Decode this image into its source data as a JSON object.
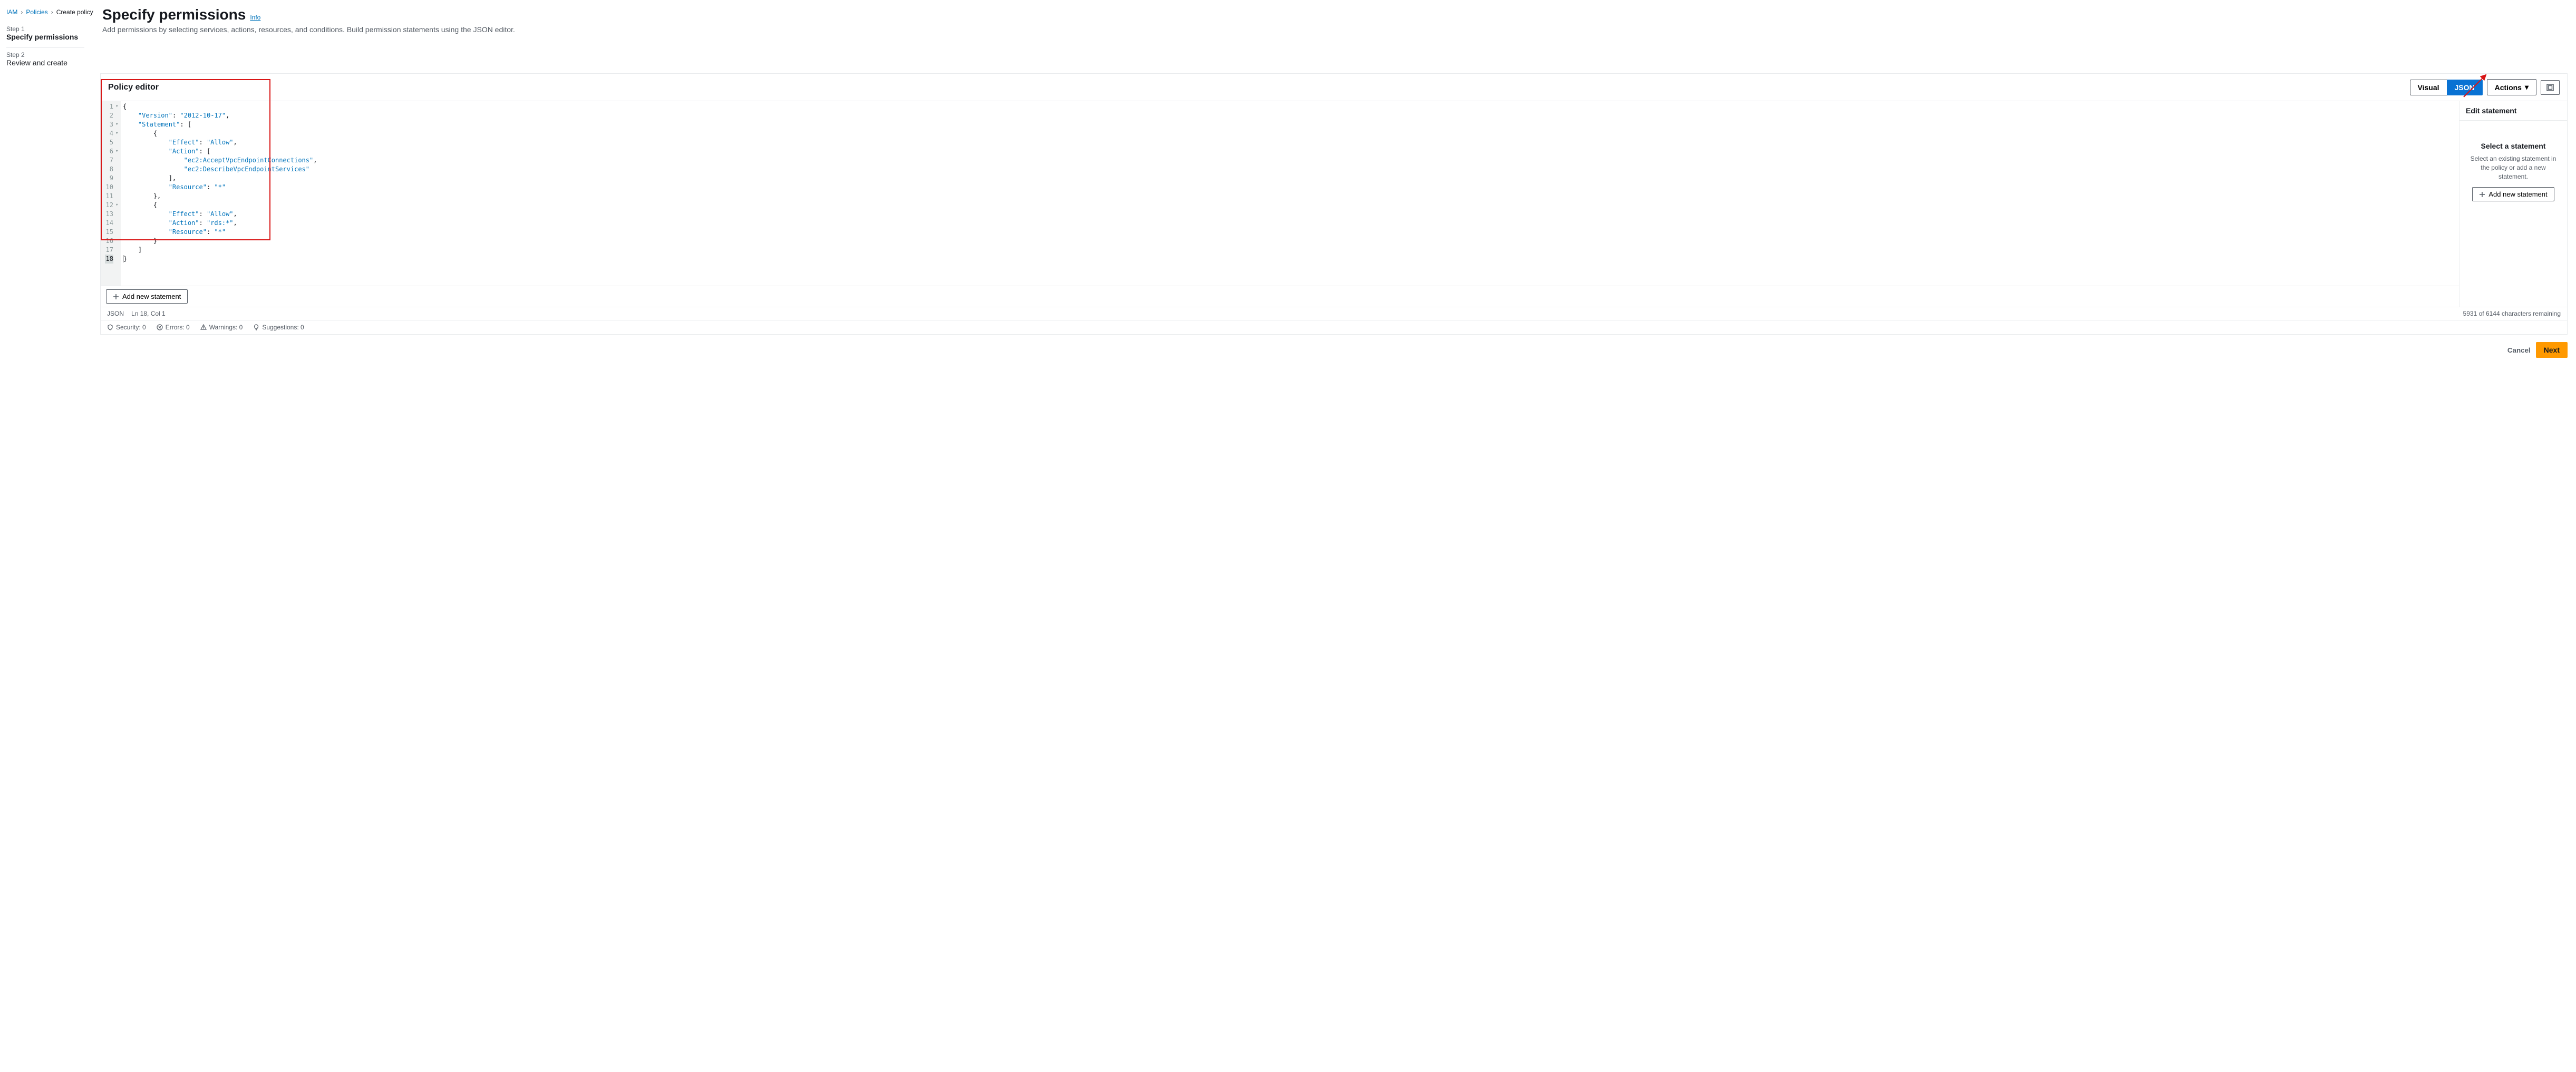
{
  "breadcrumb": {
    "iam": "IAM",
    "policies": "Policies",
    "create": "Create policy"
  },
  "steps": {
    "s1_num": "Step 1",
    "s1_name": "Specify permissions",
    "s2_num": "Step 2",
    "s2_name": "Review and create"
  },
  "title": "Specify permissions",
  "info": "Info",
  "subtitle": "Add permissions by selecting services, actions, resources, and conditions. Build permission statements using the JSON editor.",
  "editor": {
    "title": "Policy editor",
    "visual": "Visual",
    "json": "JSON",
    "actions": "Actions",
    "add_statement": "Add new statement"
  },
  "right_panel": {
    "title": "Edit statement",
    "select_title": "Select a statement",
    "select_desc": "Select an existing statement in the policy or add a new statement.",
    "add": "Add new statement"
  },
  "status": {
    "mode": "JSON",
    "cursor": "Ln 18, Col 1",
    "chars": "5931 of 6144 characters remaining"
  },
  "lint": {
    "security": "Security: 0",
    "errors": "Errors: 0",
    "warnings": "Warnings: 0",
    "suggestions": "Suggestions: 0"
  },
  "footer": {
    "cancel": "Cancel",
    "next": "Next"
  },
  "code": {
    "lines": [
      "{",
      "    \"Version\": \"2012-10-17\",",
      "    \"Statement\": [",
      "        {",
      "            \"Effect\": \"Allow\",",
      "            \"Action\": [",
      "                \"ec2:AcceptVpcEndpointConnections\",",
      "                \"ec2:DescribeVpcEndpointServices\"",
      "            ],",
      "            \"Resource\": \"*\"",
      "        },",
      "        {",
      "            \"Effect\": \"Allow\",",
      "            \"Action\": \"rds:*\",",
      "            \"Resource\": \"*\"",
      "        }",
      "    ]",
      "}"
    ],
    "line_numbers": [
      "1",
      "2",
      "3",
      "4",
      "5",
      "6",
      "7",
      "8",
      "9",
      "10",
      "11",
      "12",
      "13",
      "14",
      "15",
      "16",
      "17",
      "18"
    ],
    "folds": [
      "▾",
      "",
      "▾",
      "▾",
      "",
      "▾",
      "",
      "",
      "",
      "",
      "",
      "▾",
      "",
      "",
      "",
      "",
      "",
      ""
    ],
    "active_line": 18
  }
}
